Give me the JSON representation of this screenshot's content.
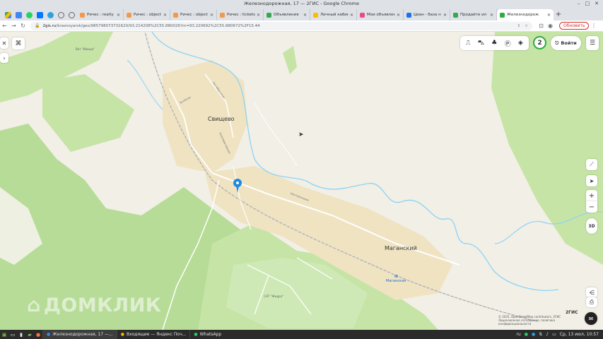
{
  "window": {
    "title": "Железнодорожная, 17 — 2ГИС - Google Chrome",
    "controls": [
      "–",
      "□",
      "✕"
    ]
  },
  "tabs": [
    {
      "label": "Ричес : realty",
      "color": "#f2994a"
    },
    {
      "label": "Ричес : object",
      "color": "#f2994a"
    },
    {
      "label": "Ричес : object",
      "color": "#f2994a"
    },
    {
      "label": "Ричес : tickets",
      "color": "#f2994a"
    },
    {
      "label": "Объявления",
      "color": "#34a853"
    },
    {
      "label": "Личный кабин",
      "color": "#fbbc04"
    },
    {
      "label": "Мои объявлен",
      "color": "#e94a8a"
    },
    {
      "label": "Циан - база н",
      "color": "#1a73e8"
    },
    {
      "label": "Продайте ил",
      "color": "#34a853"
    },
    {
      "label": "Железнодорож",
      "color": "#2eac3f",
      "active": true
    }
  ],
  "new_tab": "+",
  "address": {
    "host": "2gis.ru",
    "path": "/krasnoyarsk/geo/985798073731620/93.214208%2C55.880026?m=93.220692%2C55.880672%2F15.44",
    "update_label": "Обновить"
  },
  "map": {
    "place_labels": {
      "svishchevo": "Свищево",
      "maganskiy": "Маганский",
      "maganskaya": "Маганская",
      "sad_izhica": "Вет \"Ижица\"",
      "sad_gidra": "СНТ \"Жидра\""
    },
    "street_labels": {
      "zelenaya": "Зелёная",
      "oktyabrskaya": "Октябрьская",
      "kooperativnaya": "Кооперативная",
      "tsentralnaya": "Центральная"
    },
    "login_label": "Войти",
    "badge_value": "2",
    "zoom_in": "+",
    "zoom_out": "−",
    "mode_3d": "3D",
    "watermark": "ДОМКЛИК",
    "copyright": [
      "© 2025, OpenStreetMap contributors, 2ГИС",
      "Лицензионное соглашение, политика конфиденциальности"
    ],
    "brand": "2ГИС"
  },
  "taskbar": {
    "apps": [
      {
        "label": "Железнодорожная, 17 —...",
        "color": "#4285f4"
      },
      {
        "label": "Входящие — Яндекс Поч...",
        "color": "#f4b400"
      },
      {
        "label": "WhatsApp",
        "color": "#25d366"
      }
    ],
    "locale": "ru",
    "datetime": "Ср, 13 июл, 10:57"
  }
}
